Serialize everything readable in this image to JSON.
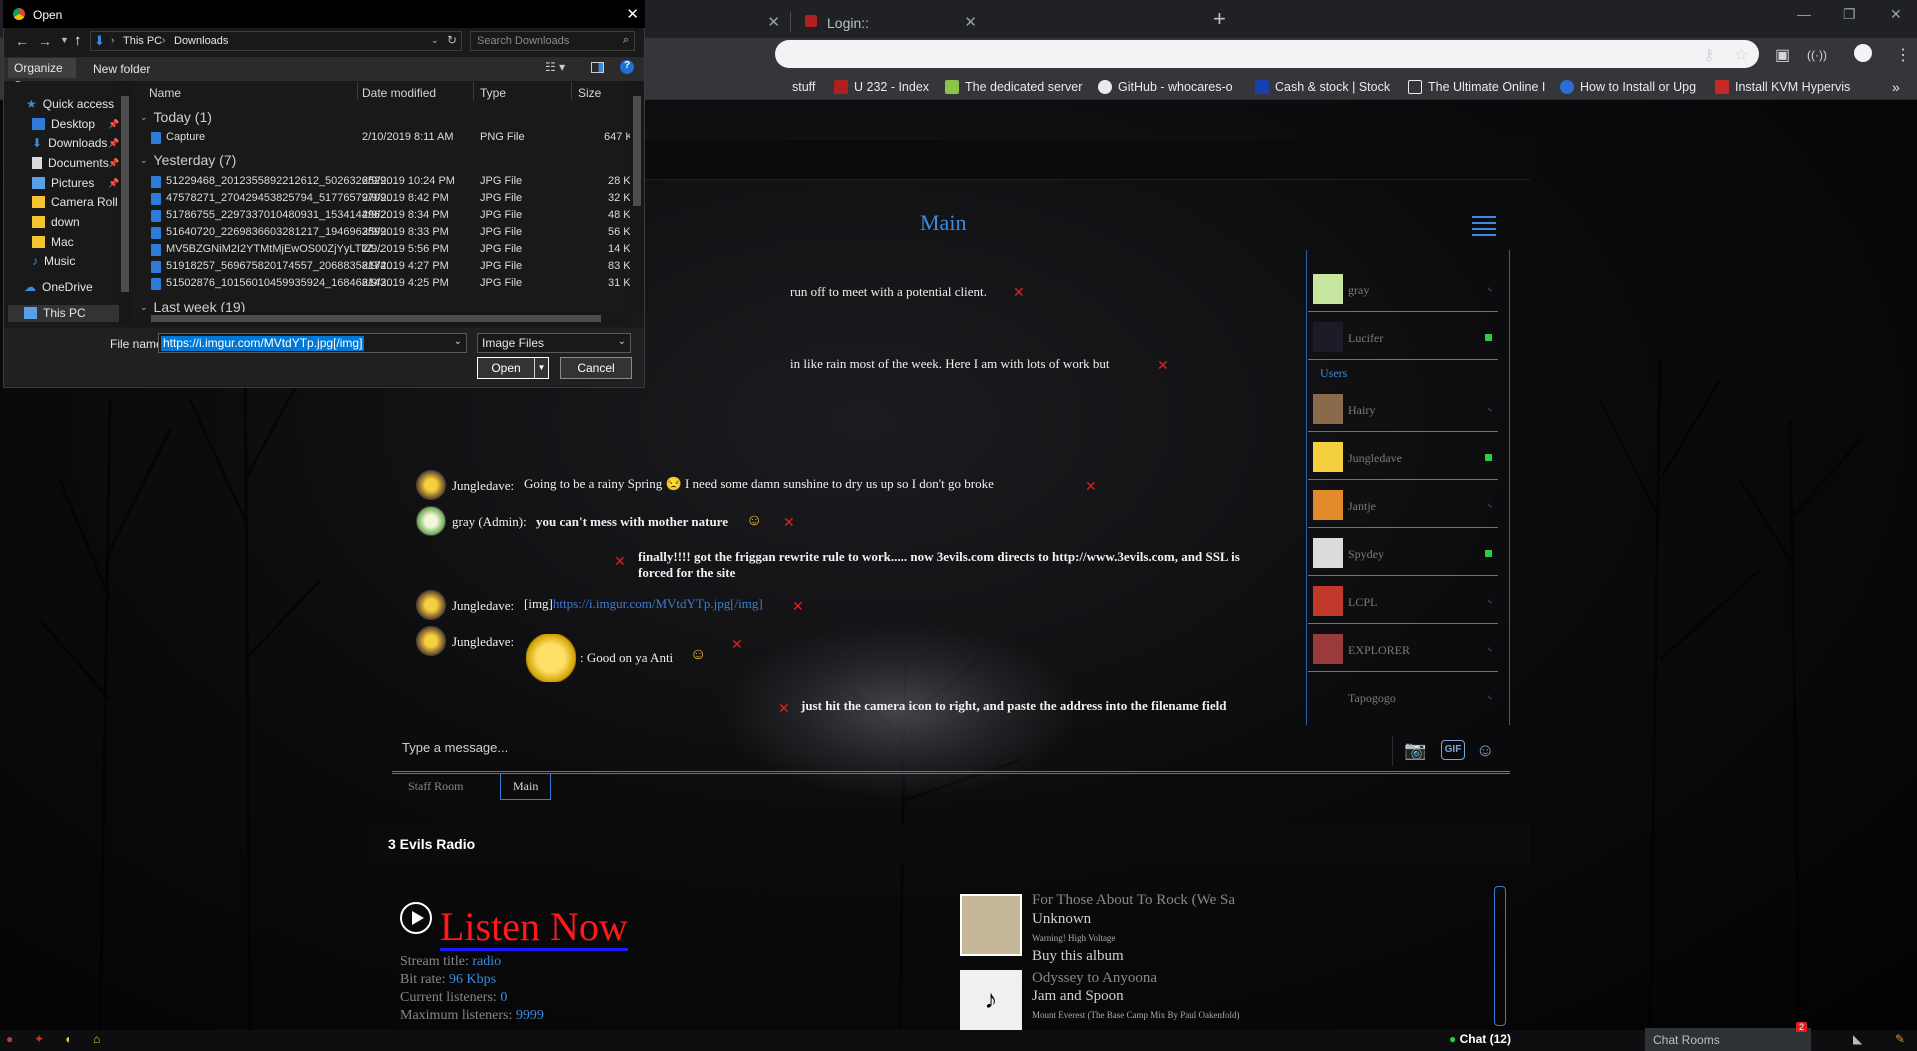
{
  "browser": {
    "tabs": [
      {
        "label": "Login::"
      }
    ],
    "bookmarks": [
      {
        "label": "stuff",
        "color": "#f4c430"
      },
      {
        "label": "U 232 - Index",
        "color": "#b02020"
      },
      {
        "label": "The dedicated server",
        "color": "#8bc34a"
      },
      {
        "label": "GitHub - whocares-o",
        "color": "#e8eaed"
      },
      {
        "label": "Cash & stock | Stock",
        "color": "#1a3fb0"
      },
      {
        "label": "The Ultimate Online I",
        "color": "#e8eaed"
      },
      {
        "label": "How to Install or Upg",
        "color": "#2b6fd6"
      },
      {
        "label": "Install KVM Hypervis",
        "color": "#c62828"
      }
    ]
  },
  "dialog": {
    "title": "Open",
    "breadcrumb": [
      "This PC",
      "Downloads"
    ],
    "search_placeholder": "Search Downloads",
    "organize_label": "Organize",
    "new_folder_label": "New folder",
    "nav": {
      "quick_access": "Quick access",
      "items": [
        "Desktop",
        "Downloads",
        "Documents",
        "Pictures",
        "Camera Roll",
        "down",
        "Mac",
        "Music"
      ],
      "onedrive": "OneDrive",
      "this_pc": "This PC"
    },
    "columns": {
      "name": "Name",
      "date": "Date modified",
      "type": "Type",
      "size": "Size"
    },
    "groups": {
      "today": "Today (1)",
      "yesterday": "Yesterday (7)",
      "last_week": "Last week (19)"
    },
    "files_today": [
      {
        "name": "Capture",
        "date": "2/10/2019 8:11 AM",
        "type": "PNG File",
        "size": "647 KB"
      }
    ],
    "files_yesterday": [
      {
        "name": "51229468_2012355892212612_5026326529...",
        "date": "2/9/2019 10:24 PM",
        "type": "JPG File",
        "size": "28 KB"
      },
      {
        "name": "47578271_270429453825794_51776579709...",
        "date": "2/9/2019 8:42 PM",
        "type": "JPG File",
        "size": "32 KB"
      },
      {
        "name": "51786755_2297337010480931_1534144962...",
        "date": "2/9/2019 8:34 PM",
        "type": "JPG File",
        "size": "48 KB"
      },
      {
        "name": "51640720_2269836603281217_1946963599...",
        "date": "2/9/2019 8:33 PM",
        "type": "JPG File",
        "size": "56 KB"
      },
      {
        "name": "MV5BZGNiM2I2YTMtMjEwOS00ZjYyLTliZ...",
        "date": "2/9/2019 5:56 PM",
        "type": "JPG File",
        "size": "14 KB"
      },
      {
        "name": "51918257_569675820174557_20688358174...",
        "date": "2/9/2019 4:27 PM",
        "type": "JPG File",
        "size": "83 KB"
      },
      {
        "name": "51502876_10156010459935924_168468143...",
        "date": "2/9/2019 4:25 PM",
        "type": "JPG File",
        "size": "31 KB"
      }
    ],
    "filename_label": "File name:",
    "filename_value": "https://i.imgur.com/MVtdYTp.jpg[/img]",
    "filter_value": "Image Files",
    "open_label": "Open",
    "cancel_label": "Cancel"
  },
  "site": {
    "main_title": "Main",
    "messages": [
      {
        "text": "run off to meet with a potential client."
      },
      {
        "text": "in like rain most of the week. Here I am with lots of work but"
      },
      {
        "user": "Jungledave:",
        "text": "Going to be a rainy Spring 😒 I need some damn sunshine to dry us up so I don't go broke"
      },
      {
        "user": "gray (Admin):",
        "text": "you can't mess with mother nature"
      },
      {
        "text": "finally!!!! got the friggan rewrite rule to work..... now 3evils.com directs to http://www.3evils.com, and SSL is forced for the site"
      },
      {
        "user": "Jungledave:",
        "prefix": "[img]",
        "link": "https://i.imgur.com/MVtdYTp.jpg[/img]"
      },
      {
        "user": "Jungledave:",
        "text": ": Good on ya Anti"
      },
      {
        "text": "just hit the camera icon to right, and paste the address into the filename field"
      }
    ],
    "staff_users": [
      {
        "name": "gray",
        "status": "idle"
      },
      {
        "name": "Lucifer",
        "status": "online"
      }
    ],
    "users_header": "Users",
    "users": [
      {
        "name": "Hairy",
        "status": "idle"
      },
      {
        "name": "Jungledave",
        "status": "online"
      },
      {
        "name": "Jantje",
        "status": "idle"
      },
      {
        "name": "Spydey",
        "status": "online"
      },
      {
        "name": "LCPL",
        "status": "idle"
      },
      {
        "name": "EXPLORER",
        "status": "idle"
      },
      {
        "name": "Tapogogo",
        "status": "idle"
      }
    ],
    "input_placeholder": "Type a message...",
    "room_tabs": [
      "Staff Room",
      "Main"
    ],
    "radio": {
      "title": "3 Evils Radio",
      "listen_label": "Listen Now",
      "stream_title_label": "Stream title:",
      "stream_title_value": "radio",
      "bitrate_label": "Bit rate:",
      "bitrate_value": "96 Kbps",
      "current_label": "Current listeners:",
      "current_value": "0",
      "max_label": "Maximum listeners:",
      "max_value": "9999",
      "tracks": [
        {
          "title": "For Those About To Rock (We Sa",
          "artist": "Unknown",
          "album": "Warning! High Voltage",
          "buy": "Buy this album"
        },
        {
          "title": "Odyssey to Anyoona",
          "artist": "Jam and Spoon",
          "album": "Mount Everest (The Base Camp Mix By Paul Oakenfold)"
        }
      ]
    },
    "chat_label": "Chat (12)",
    "chat_rooms_label": "Chat Rooms",
    "notif_count": "2"
  },
  "colors": {
    "accent": "#3a8be0",
    "delete": "#e02020",
    "online": "#2ecc40",
    "selection": "#0078d7"
  }
}
